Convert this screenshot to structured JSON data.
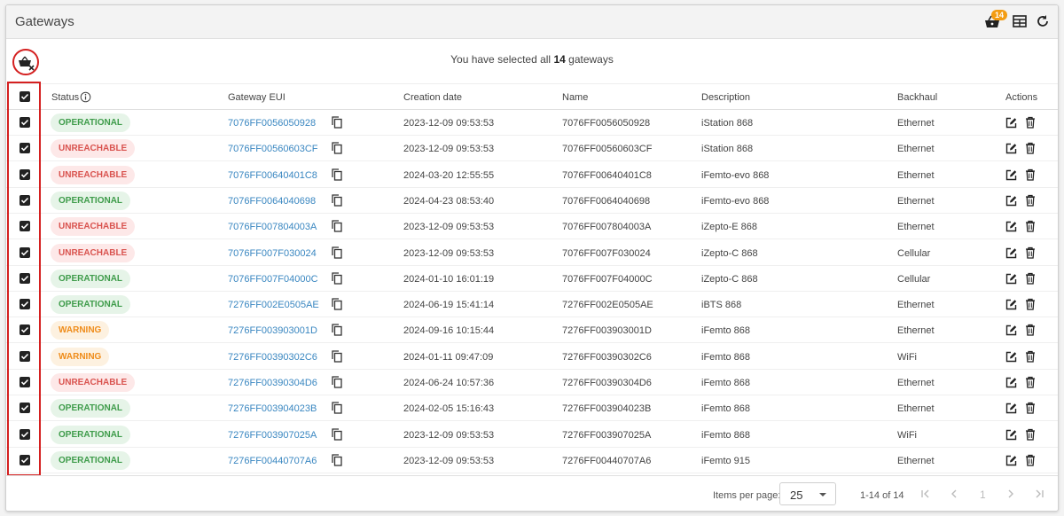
{
  "header": {
    "title": "Gateways",
    "cart_count": "14"
  },
  "selection": {
    "prefix": "You have selected all",
    "count": "14",
    "suffix": "gateways"
  },
  "columns": {
    "status": "Status",
    "eui": "Gateway EUI",
    "created": "Creation date",
    "name": "Name",
    "description": "Description",
    "backhaul": "Backhaul",
    "actions": "Actions"
  },
  "status_colors": {
    "OPERATIONAL": "#3f9c4b",
    "UNREACHABLE": "#d9534f",
    "WARNING": "#ef8c1a"
  },
  "rows": [
    {
      "status": "OPERATIONAL",
      "eui": "7076FF0056050928",
      "created": "2023-12-09 09:53:53",
      "name": "7076FF0056050928",
      "description": "iStation 868",
      "backhaul": "Ethernet"
    },
    {
      "status": "UNREACHABLE",
      "eui": "7076FF00560603CF",
      "created": "2023-12-09 09:53:53",
      "name": "7076FF00560603CF",
      "description": "iStation 868",
      "backhaul": "Ethernet"
    },
    {
      "status": "UNREACHABLE",
      "eui": "7076FF00640401C8",
      "created": "2024-03-20 12:55:55",
      "name": "7076FF00640401C8",
      "description": "iFemto-evo 868",
      "backhaul": "Ethernet"
    },
    {
      "status": "OPERATIONAL",
      "eui": "7076FF0064040698",
      "created": "2024-04-23 08:53:40",
      "name": "7076FF0064040698",
      "description": "iFemto-evo 868",
      "backhaul": "Ethernet"
    },
    {
      "status": "UNREACHABLE",
      "eui": "7076FF007804003A",
      "created": "2023-12-09 09:53:53",
      "name": "7076FF007804003A",
      "description": "iZepto-E 868",
      "backhaul": "Ethernet"
    },
    {
      "status": "UNREACHABLE",
      "eui": "7076FF007F030024",
      "created": "2023-12-09 09:53:53",
      "name": "7076FF007F030024",
      "description": "iZepto-C 868",
      "backhaul": "Cellular"
    },
    {
      "status": "OPERATIONAL",
      "eui": "7076FF007F04000C",
      "created": "2024-01-10 16:01:19",
      "name": "7076FF007F04000C",
      "description": "iZepto-C 868",
      "backhaul": "Cellular"
    },
    {
      "status": "OPERATIONAL",
      "eui": "7276FF002E0505AE",
      "created": "2024-06-19 15:41:14",
      "name": "7276FF002E0505AE",
      "description": "iBTS 868",
      "backhaul": "Ethernet"
    },
    {
      "status": "WARNING",
      "eui": "7276FF003903001D",
      "created": "2024-09-16 10:15:44",
      "name": "7276FF003903001D",
      "description": "iFemto 868",
      "backhaul": "Ethernet"
    },
    {
      "status": "WARNING",
      "eui": "7276FF00390302C6",
      "created": "2024-01-11 09:47:09",
      "name": "7276FF00390302C6",
      "description": "iFemto 868",
      "backhaul": "WiFi"
    },
    {
      "status": "UNREACHABLE",
      "eui": "7276FF00390304D6",
      "created": "2024-06-24 10:57:36",
      "name": "7276FF00390304D6",
      "description": "iFemto 868",
      "backhaul": "Ethernet"
    },
    {
      "status": "OPERATIONAL",
      "eui": "7276FF003904023B",
      "created": "2024-02-05 15:16:43",
      "name": "7276FF003904023B",
      "description": "iFemto 868",
      "backhaul": "Ethernet"
    },
    {
      "status": "OPERATIONAL",
      "eui": "7276FF003907025A",
      "created": "2023-12-09 09:53:53",
      "name": "7276FF003907025A",
      "description": "iFemto 868",
      "backhaul": "WiFi"
    },
    {
      "status": "OPERATIONAL",
      "eui": "7276FF00440707A6",
      "created": "2023-12-09 09:53:53",
      "name": "7276FF00440707A6",
      "description": "iFemto 915",
      "backhaul": "Ethernet"
    }
  ],
  "footer": {
    "items_per_page_label": "Items per page:",
    "items_per_page": "25",
    "range": "1-14 of 14",
    "current_page": "1"
  }
}
